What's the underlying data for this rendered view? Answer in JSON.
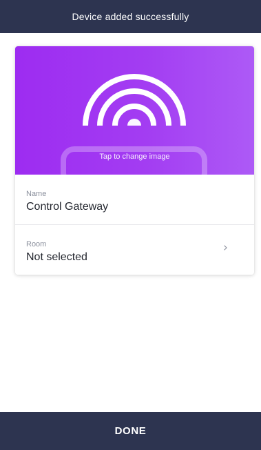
{
  "header": {
    "title": "Device added successfully"
  },
  "device_card": {
    "image_action_label": "Tap to change image",
    "image_icon": "wifi-signal-router-icon",
    "name_label": "Name",
    "name_value": "Control Gateway",
    "room_label": "Room",
    "room_value": "Not selected",
    "room_chevron_icon": "chevron-right-icon"
  },
  "footer": {
    "done_label": "DONE"
  },
  "colors": {
    "nav_background": "#2d3450",
    "image_gradient_start": "#9d2cf1",
    "image_gradient_end": "#ad5af6"
  }
}
